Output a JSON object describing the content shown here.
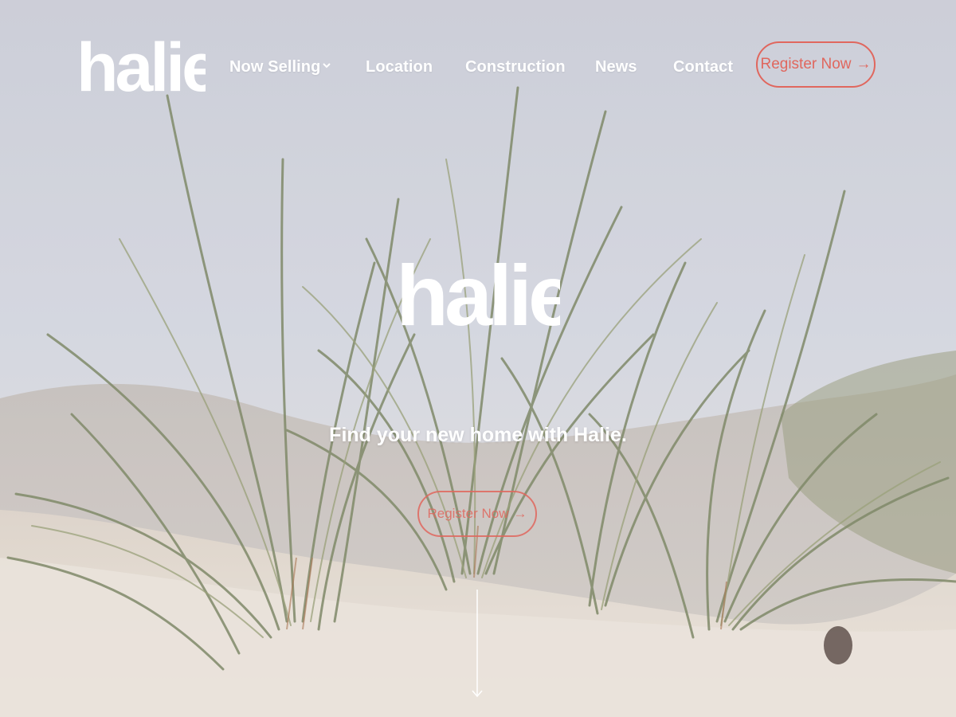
{
  "brand": {
    "logo_text": "halie",
    "logo_color": "#ffffff"
  },
  "nav": {
    "items": [
      {
        "label": "Now Selling",
        "has_dropdown": true,
        "icon": "chevron-down-icon"
      },
      {
        "label": "Location",
        "has_dropdown": false
      },
      {
        "label": "Construction",
        "has_dropdown": false
      },
      {
        "label": "News",
        "has_dropdown": false
      },
      {
        "label": "Contact",
        "has_dropdown": false
      }
    ],
    "cta": {
      "label": "Register Now",
      "arrow": "→",
      "icon": "arrow-right-icon"
    }
  },
  "hero": {
    "logo_text": "halie",
    "tagline": "Find your new home with Halie.",
    "cta": {
      "label": "Register Now",
      "arrow": "→",
      "icon": "arrow-right-icon"
    },
    "scroll_icon": "arrow-down-icon",
    "background": "beach-dune-grass-photo"
  },
  "colors": {
    "accent": "#e0675e",
    "text_light": "#ffffff",
    "sky": "#c9cbd6",
    "sand": "#e6ddd2",
    "grass": "#7d8a62"
  }
}
